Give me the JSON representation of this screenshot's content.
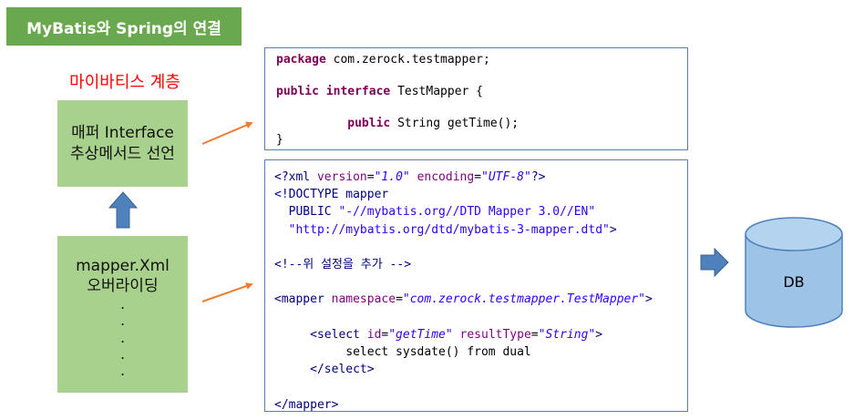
{
  "title": "MyBatis와 Spring의 연결",
  "layer_label": "마이바티스 계층",
  "mapper_box": {
    "line1": "매퍼 Interface",
    "line2": "추상메서드 선언"
  },
  "xml_box": {
    "line1": "mapper.Xml",
    "line2": "오버라이딩",
    "dots": [
      ".",
      ".",
      ".",
      ".",
      "."
    ]
  },
  "java_code": {
    "line1_kw": "package",
    "line1_rest": " com.zerock.testmapper;",
    "line2_kw1": "public",
    "line2_kw2": "interface",
    "line2_rest": " TestMapper {",
    "line3_indent": "          ",
    "line3_kw": "public",
    "line3_rest": " String getTime();",
    "line4": "}"
  },
  "xml_code": {
    "decl_start": "<?xml ",
    "decl_attr1": "version",
    "decl_eq1": "=",
    "decl_val1": "\"1.0\"",
    "decl_sp": " ",
    "decl_attr2": "encoding",
    "decl_eq2": "=",
    "decl_val2": "\"UTF-8\"",
    "decl_end": "?>",
    "doctype": "<!DOCTYPE mapper",
    "public_kw": "  PUBLIC ",
    "public_val": "\"-//mybatis.org//DTD Mapper 3.0//EN\"",
    "dtd_indent": "  ",
    "dtd_val": "\"http://mybatis.org/dtd/mybatis-3-mapper.dtd\"",
    "dtd_end": ">",
    "comment": "<!--위 설정을 추가 -->",
    "mapper_open": "<mapper ",
    "mapper_attr": "namespace",
    "mapper_eq": "=",
    "mapper_val": "\"com.zerock.testmapper.TestMapper\"",
    "mapper_gt": ">",
    "select_open": "     <select ",
    "select_attr1": "id",
    "select_eq1": "=",
    "select_val1": "\"getTime\"",
    "select_sp": " ",
    "select_attr2": "resultType",
    "select_eq2": "=",
    "select_val2": "\"String\"",
    "select_gt": ">",
    "sql": "          select sysdate() from dual",
    "select_close": "     </select>",
    "mapper_close": "</mapper>"
  },
  "db_label": "DB",
  "colors": {
    "title_bg": "#6aa84f",
    "box_green": "#a9d18e",
    "arrow_orange": "#ed7d31",
    "arrow_blue": "#4f81bd",
    "db_fill": "#9dc3e6",
    "label_red": "#ff0000"
  }
}
